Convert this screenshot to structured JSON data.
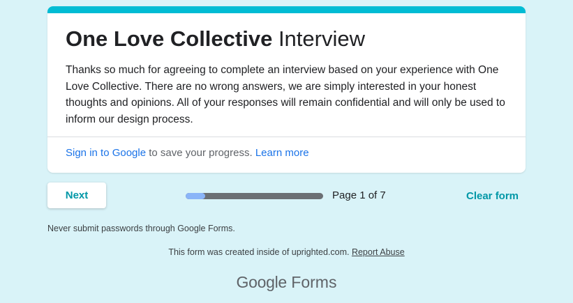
{
  "header": {
    "title_bold": "One Love Collective",
    "title_rest": " Interview",
    "description": "Thanks so much for agreeing to complete an interview based on your experience with One Love Collective. There are no wrong answers, we are simply interested in your honest thoughts and opinions. All of your responses will remain confidential and will only be used to inform our design process."
  },
  "signin": {
    "link_label": "Sign in to Google",
    "text": " to save your progress. ",
    "learn_more_label": "Learn more"
  },
  "navigation": {
    "next_label": "Next",
    "progress_fraction": 0.143,
    "page_label": "Page 1 of 7",
    "clear_label": "Clear form"
  },
  "footer": {
    "warning": "Never submit passwords through Google Forms.",
    "created_text": "This form was created inside of uprighted.com. ",
    "report_abuse_label": "Report Abuse",
    "logo_brand": "Google",
    "logo_product": " Forms"
  },
  "colors": {
    "background": "#d9f3f8",
    "accent_bar": "#00bcd4",
    "button_text": "#0097a7",
    "link": "#1a73e8",
    "progress_track": "#6b6f74",
    "progress_fill": "#8ab4f8"
  }
}
